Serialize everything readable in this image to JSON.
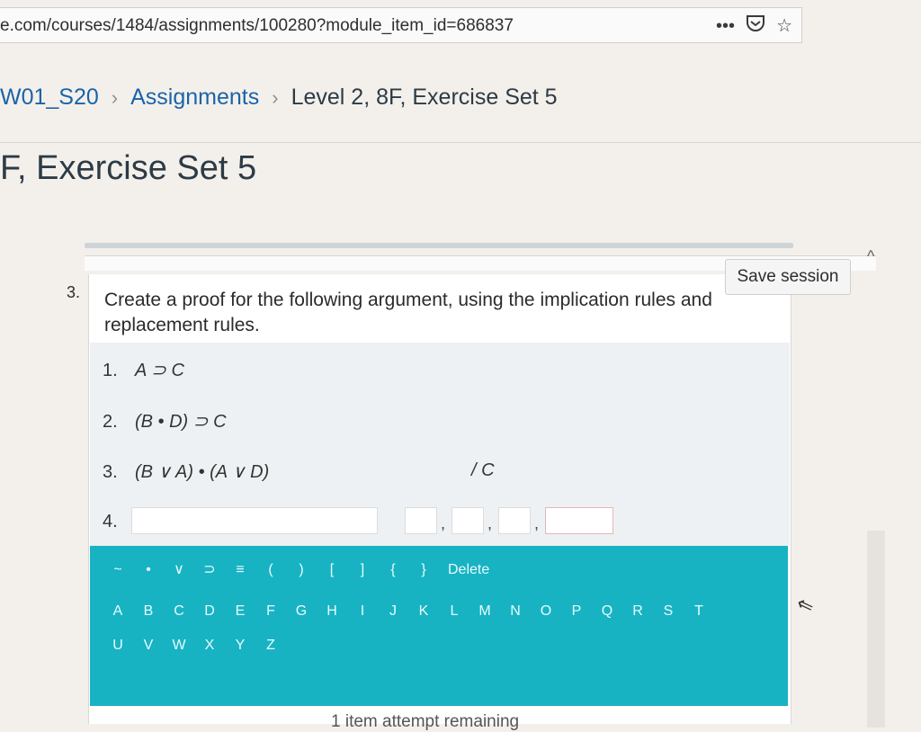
{
  "browser": {
    "url": "e.com/courses/1484/assignments/100280?module_item_id=686837",
    "menu_icon": "more-icon",
    "pocket_icon": "pocket-icon",
    "bookmark_icon": "star-icon"
  },
  "breadcrumb": {
    "course": "W01_S20",
    "section": "Assignments",
    "current": "Level 2, 8F, Exercise Set 5",
    "separator": "›"
  },
  "page_title": "F, Exercise Set 5",
  "save_session": "Save session",
  "question": {
    "number": "3.",
    "prompt": "Create a proof for the following argument, using the implication rules and replacement rules.",
    "lines": [
      {
        "num": "1.",
        "formula": "A ⊃ C"
      },
      {
        "num": "2.",
        "formula": "(B • D) ⊃ C"
      },
      {
        "num": "3.",
        "formula": "(B ∨ A) • (A ∨ D)"
      }
    ],
    "conclusion": "/ C",
    "next_line_num": "4."
  },
  "keyboard": {
    "symbols": [
      "~",
      "•",
      "∨",
      "⊃",
      "≡",
      "(",
      ")",
      "[",
      "]",
      "{",
      "}"
    ],
    "delete_label": "Delete",
    "row2": [
      "A",
      "B",
      "C",
      "D",
      "E",
      "F",
      "G",
      "H",
      "I",
      "J",
      "K",
      "L",
      "M",
      "N",
      "O",
      "P",
      "Q",
      "R",
      "S",
      "T"
    ],
    "row3": [
      "U",
      "V",
      "W",
      "X",
      "Y",
      "Z"
    ]
  },
  "attempts": "1 item attempt remaining"
}
